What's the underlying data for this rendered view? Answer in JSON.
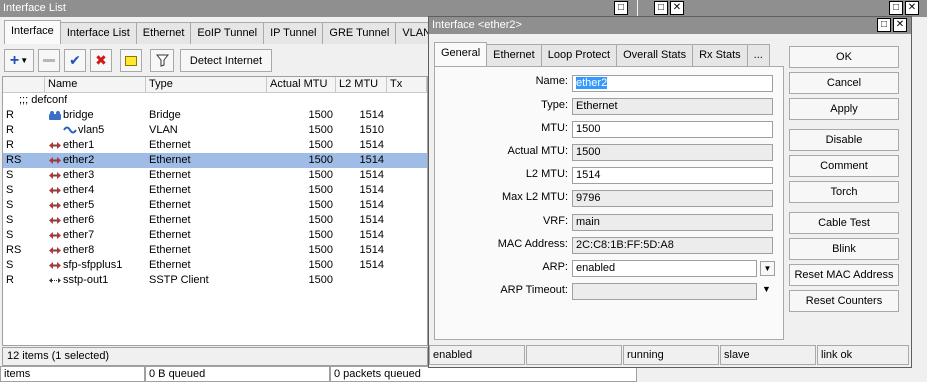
{
  "main_window": {
    "title": "Interface List",
    "tabs": [
      "Interface",
      "Interface List",
      "Ethernet",
      "EoIP Tunnel",
      "IP Tunnel",
      "GRE Tunnel",
      "VLAN"
    ],
    "detect_internet_label": "Detect Internet",
    "columns": [
      "Name",
      "Type",
      "Actual MTU",
      "L2 MTU",
      "Tx"
    ],
    "group_label": ";;; defconf",
    "rows": [
      {
        "flag": "R",
        "name": "bridge",
        "type": "Bridge",
        "mtu": "1500",
        "l2mtu": "1514",
        "icon": "bridge-icon",
        "indent": false,
        "selected": false
      },
      {
        "flag": "R",
        "name": "vlan5",
        "type": "VLAN",
        "mtu": "1500",
        "l2mtu": "1510",
        "icon": "vlan-icon",
        "indent": true,
        "selected": false
      },
      {
        "flag": "R",
        "name": "ether1",
        "type": "Ethernet",
        "mtu": "1500",
        "l2mtu": "1514",
        "icon": "ethernet-icon",
        "indent": false,
        "selected": false
      },
      {
        "flag": "RS",
        "name": "ether2",
        "type": "Ethernet",
        "mtu": "1500",
        "l2mtu": "1514",
        "icon": "ethernet-icon",
        "indent": false,
        "selected": true
      },
      {
        "flag": "S",
        "name": "ether3",
        "type": "Ethernet",
        "mtu": "1500",
        "l2mtu": "1514",
        "icon": "ethernet-icon",
        "indent": false,
        "selected": false
      },
      {
        "flag": "S",
        "name": "ether4",
        "type": "Ethernet",
        "mtu": "1500",
        "l2mtu": "1514",
        "icon": "ethernet-icon",
        "indent": false,
        "selected": false
      },
      {
        "flag": "S",
        "name": "ether5",
        "type": "Ethernet",
        "mtu": "1500",
        "l2mtu": "1514",
        "icon": "ethernet-icon",
        "indent": false,
        "selected": false
      },
      {
        "flag": "S",
        "name": "ether6",
        "type": "Ethernet",
        "mtu": "1500",
        "l2mtu": "1514",
        "icon": "ethernet-icon",
        "indent": false,
        "selected": false
      },
      {
        "flag": "S",
        "name": "ether7",
        "type": "Ethernet",
        "mtu": "1500",
        "l2mtu": "1514",
        "icon": "ethernet-icon",
        "indent": false,
        "selected": false
      },
      {
        "flag": "RS",
        "name": "ether8",
        "type": "Ethernet",
        "mtu": "1500",
        "l2mtu": "1514",
        "icon": "ethernet-icon",
        "indent": false,
        "selected": false
      },
      {
        "flag": "S",
        "name": "sfp-sfpplus1",
        "type": "Ethernet",
        "mtu": "1500",
        "l2mtu": "1514",
        "icon": "ethernet-icon",
        "indent": false,
        "selected": false
      },
      {
        "flag": "R",
        "name": "sstp-out1",
        "type": "SSTP Client",
        "mtu": "1500",
        "l2mtu": "",
        "icon": "tunnel-icon",
        "indent": false,
        "selected": false
      }
    ],
    "status": "12 items (1 selected)",
    "bottom_strip": [
      "items",
      "0 B queued",
      "0 packets queued"
    ]
  },
  "dialog": {
    "title": "Interface <ether2>",
    "tabs": [
      "General",
      "Ethernet",
      "Loop Protect",
      "Overall Stats",
      "Rx Stats",
      "..."
    ],
    "fields": {
      "name": {
        "label": "Name:",
        "value": "ether2"
      },
      "type": {
        "label": "Type:",
        "value": "Ethernet"
      },
      "mtu": {
        "label": "MTU:",
        "value": "1500"
      },
      "actual_mtu": {
        "label": "Actual MTU:",
        "value": "1500"
      },
      "l2_mtu": {
        "label": "L2 MTU:",
        "value": "1514"
      },
      "max_l2_mtu": {
        "label": "Max L2 MTU:",
        "value": "9796"
      },
      "vrf": {
        "label": "VRF:",
        "value": "main"
      },
      "mac": {
        "label": "MAC Address:",
        "value": "2C:C8:1B:FF:5D:A8"
      },
      "arp": {
        "label": "ARP:",
        "value": "enabled"
      },
      "arp_timeout": {
        "label": "ARP Timeout:",
        "value": ""
      }
    },
    "buttons": [
      "OK",
      "Cancel",
      "Apply",
      "Disable",
      "Comment",
      "Torch",
      "Cable Test",
      "Blink",
      "Reset MAC Address",
      "Reset Counters"
    ],
    "status": [
      "enabled",
      "",
      "running",
      "slave",
      "link ok"
    ]
  }
}
